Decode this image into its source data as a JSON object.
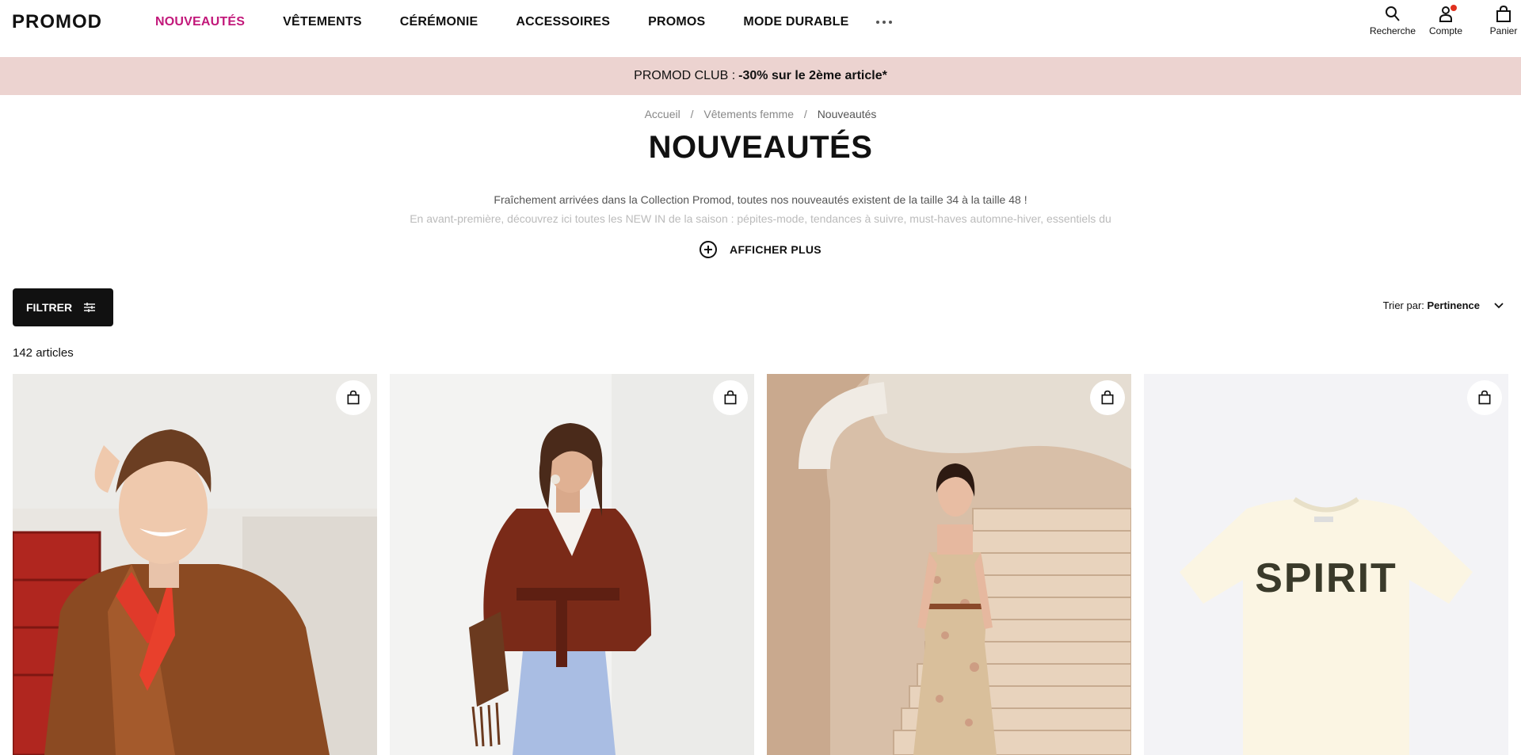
{
  "brand": {
    "logo": "PROMOD"
  },
  "nav": {
    "items": [
      {
        "label": "NOUVEAUTÉS",
        "active": true
      },
      {
        "label": "VÊTEMENTS"
      },
      {
        "label": "CÉRÉMONIE"
      },
      {
        "label": "ACCESSOIRES"
      },
      {
        "label": "PROMOS"
      },
      {
        "label": "MODE DURABLE"
      }
    ],
    "more_icon": "ellipsis-icon"
  },
  "header_actions": {
    "search": {
      "label": "Recherche",
      "icon": "search-icon"
    },
    "account": {
      "label": "Compte",
      "icon": "user-icon",
      "notification": true
    },
    "cart": {
      "label": "Panier",
      "icon": "shopping-bag-icon"
    }
  },
  "promo_banner": {
    "prefix": "PROMOD CLUB :",
    "highlight": "-30% sur le 2ème article*"
  },
  "breadcrumb": {
    "items": [
      "Accueil",
      "Vêtements femme",
      "Nouveautés"
    ],
    "separator": "/"
  },
  "page": {
    "title": "NOUVEAUTÉS",
    "description_line1": "Fraîchement arrivées dans la Collection Promod, toutes nos nouveautés existent de la taille 34 à la taille 48 !",
    "description_line2": "En avant-première, découvrez ici toutes les NEW IN de la saison : pépites-mode, tendances à suivre, must-haves automne-hiver, essentiels du",
    "show_more": "AFFICHER PLUS"
  },
  "toolbar": {
    "filter_label": "FILTRER",
    "sort_prefix": "Trier par:",
    "sort_value": "Pertinence"
  },
  "results": {
    "count": "142 articles"
  },
  "products": [
    {
      "image": "woman in brown suede jacket and red bandana"
    },
    {
      "image": "woman in rust belted trench jacket with fringe bag"
    },
    {
      "image": "woman in floral strapless maxi dress on staircase"
    },
    {
      "image": "cream t-shirt with SPIRIT print",
      "print_text": "SPIRIT"
    }
  ],
  "colors": {
    "accent": "#c2187a",
    "banner_bg": "#ecd3d0",
    "notification": "#e0301e"
  }
}
